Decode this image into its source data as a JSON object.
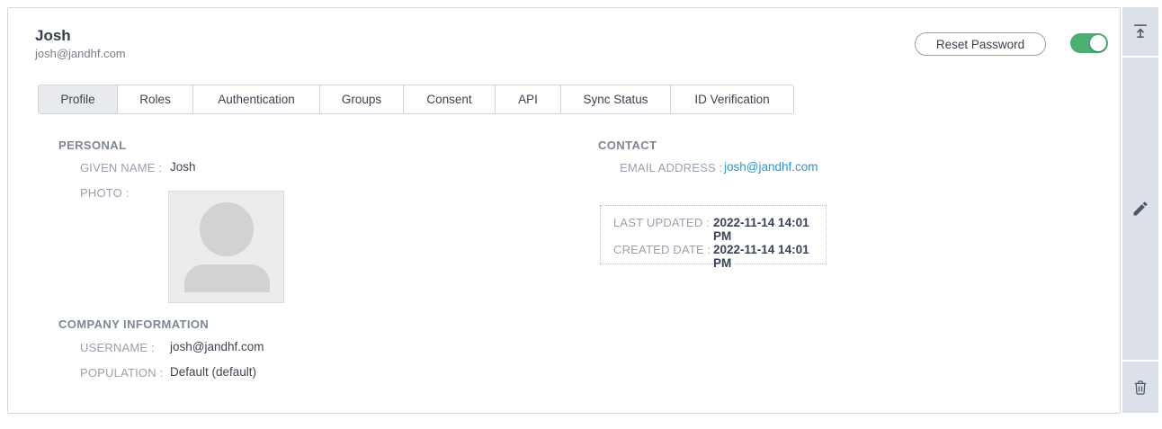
{
  "header": {
    "title": "Josh",
    "subtitle": "josh@jandhf.com",
    "reset_password_label": "Reset Password",
    "user_enabled_toggle": "on"
  },
  "tabs": [
    {
      "label": "Profile",
      "active": true
    },
    {
      "label": "Roles",
      "active": false
    },
    {
      "label": "Authentication",
      "active": false
    },
    {
      "label": "Groups",
      "active": false
    },
    {
      "label": "Consent",
      "active": false
    },
    {
      "label": "API",
      "active": false
    },
    {
      "label": "Sync Status",
      "active": false
    },
    {
      "label": "ID Verification",
      "active": false
    }
  ],
  "sections": {
    "personal": {
      "heading": "PERSONAL",
      "given_name": {
        "label": "GIVEN NAME :",
        "value": "Josh"
      },
      "photo": {
        "label": "PHOTO :"
      }
    },
    "contact": {
      "heading": "CONTACT",
      "email": {
        "label": "EMAIL ADDRESS :",
        "value": "josh@jandhf.com"
      }
    },
    "timestamps": {
      "last_updated": {
        "label": "LAST UPDATED :",
        "value": "2022-11-14 14:01 PM"
      },
      "created_date": {
        "label": "CREATED DATE :",
        "value": "2022-11-14 14:01 PM"
      }
    },
    "company": {
      "heading": "COMPANY INFORMATION",
      "username": {
        "label": "USERNAME :",
        "value": "josh@jandhf.com"
      },
      "population": {
        "label": "POPULATION :",
        "value": "Default (default)"
      }
    }
  },
  "sidebar": {
    "icons": [
      {
        "name": "collapse-top-icon"
      },
      {
        "name": "edit-icon"
      },
      {
        "name": "delete-icon"
      }
    ]
  },
  "colors": {
    "accent_link": "#2996cc",
    "toggle_on": "#4caf72",
    "sidebar_bg": "#dce0e8",
    "active_tab_bg": "#e8eaed",
    "card_border": "#d8d8d8"
  }
}
